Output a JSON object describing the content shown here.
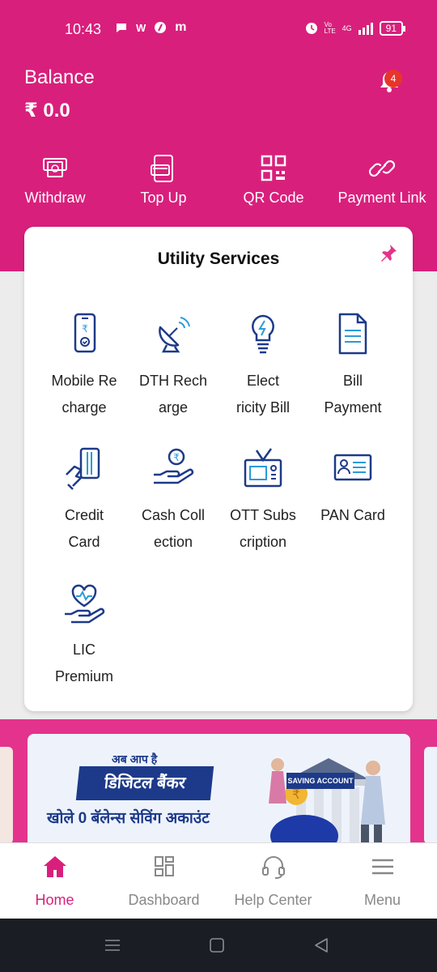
{
  "status_bar": {
    "time": "10:43",
    "left_icons": [
      "chat-icon",
      "W",
      "link-icon",
      "m"
    ],
    "network": "4G",
    "volte": "Vo LTE",
    "battery": "91"
  },
  "balance": {
    "label": "Balance",
    "value": "₹ 0.0"
  },
  "notifications": {
    "count": "4"
  },
  "actions": [
    {
      "label": "Withdraw",
      "icon": "atm-withdraw-icon"
    },
    {
      "label": "Top Up",
      "icon": "wallet-topup-icon"
    },
    {
      "label": "QR Code",
      "icon": "qr-code-icon"
    },
    {
      "label": "Payment Link",
      "icon": "link-icon"
    }
  ],
  "utility": {
    "title": "Utility Services",
    "services": [
      {
        "label": "Mobile Re charge",
        "line1": "Mobile Re",
        "line2": "charge",
        "icon": "mobile-recharge-icon"
      },
      {
        "label": "DTH Rech arge",
        "line1": "DTH Rech",
        "line2": "arge",
        "icon": "satellite-dish-icon"
      },
      {
        "label": "Elect ricity Bill",
        "line1": "Elect",
        "line2": "ricity Bill",
        "icon": "bulb-icon"
      },
      {
        "label": "Bill Payment",
        "line1": "Bill",
        "line2": "Payment",
        "icon": "document-icon"
      },
      {
        "label": "Credit Card",
        "line1": "Credit",
        "line2": "Card",
        "icon": "credit-card-icon"
      },
      {
        "label": "Cash Coll ection",
        "line1": "Cash Coll",
        "line2": "ection",
        "icon": "cash-collection-icon"
      },
      {
        "label": "OTT Subs cription",
        "line1": "OTT Subs",
        "line2": "cription",
        "icon": "tv-icon"
      },
      {
        "label": "PAN Card",
        "line1": "PAN Card",
        "line2": "",
        "icon": "id-card-icon"
      },
      {
        "label": "LIC Premium",
        "line1": "LIC",
        "line2": "Premium",
        "icon": "heart-hand-icon"
      }
    ]
  },
  "banner": {
    "line1": "अब आप है",
    "line2": "डिजिटल बैंकर",
    "line3": "खोले 0 बॅलेन्स सेविंग अकाउंट",
    "board": "SAVING ACCOUNT"
  },
  "bottom_nav": [
    {
      "label": "Home",
      "icon": "home-icon",
      "active": true
    },
    {
      "label": "Dashboard",
      "icon": "dashboard-icon",
      "active": false
    },
    {
      "label": "Help Center",
      "icon": "headset-icon",
      "active": false
    },
    {
      "label": "Menu",
      "icon": "menu-icon",
      "active": false
    }
  ],
  "colors": {
    "brand": "#d91f7c",
    "icon_blue": "#1d3a8a",
    "badge": "#e8352c"
  }
}
